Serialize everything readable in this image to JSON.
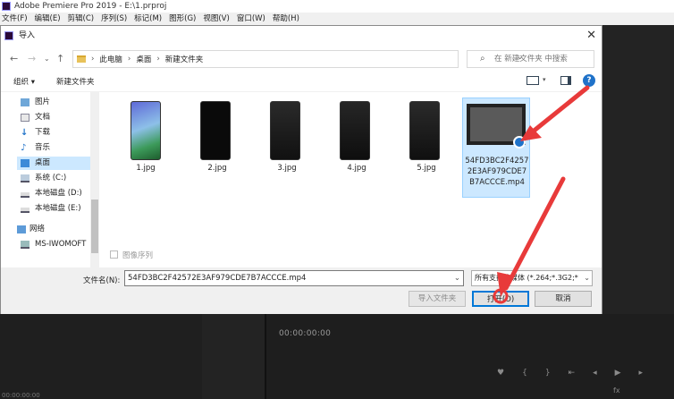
{
  "app": {
    "title": "Adobe Premiere Pro 2019 - E:\\1.prproj",
    "menu": [
      "文件(F)",
      "编辑(E)",
      "剪辑(C)",
      "序列(S)",
      "标记(M)",
      "图形(G)",
      "视图(V)",
      "窗口(W)",
      "帮助(H)"
    ],
    "program_timecode": "00:00:00:00",
    "source_timecode": "00:00:00:00",
    "fx_label": "fx"
  },
  "dialog": {
    "title": "导入",
    "breadcrumb": [
      "此电脑",
      "桌面",
      "新建文件夹"
    ],
    "search_placeholder": "在 新建文件夹 中搜索",
    "toolbar": {
      "organize": "组织 ▾",
      "new_folder": "新建文件夹"
    },
    "sidebar": [
      {
        "label": "图片",
        "icon": "pictures-icon"
      },
      {
        "label": "文档",
        "icon": "documents-icon"
      },
      {
        "label": "下载",
        "icon": "download-icon"
      },
      {
        "label": "音乐",
        "icon": "music-icon"
      },
      {
        "label": "桌面",
        "icon": "desktop-icon",
        "selected": true
      },
      {
        "label": "系统 (C:)",
        "icon": "drive-icon"
      },
      {
        "label": "本地磁盘 (D:)",
        "icon": "drive-icon"
      },
      {
        "label": "本地磁盘 (E:)",
        "icon": "drive-icon"
      },
      {
        "label": "网络",
        "icon": "network-icon"
      },
      {
        "label": "MS-IWOMOFT",
        "icon": "computer-icon"
      }
    ],
    "files": [
      {
        "name": "1.jpg"
      },
      {
        "name": "2.jpg"
      },
      {
        "name": "3.jpg"
      },
      {
        "name": "4.jpg"
      },
      {
        "name": "5.jpg"
      },
      {
        "name": "54FD3BC2F42572E3AF979CDE7B7ACCCE.mp4",
        "selected": true
      }
    ],
    "image_sequence_label": "图像序列",
    "filename_label": "文件名(N):",
    "filename_value": "54FD3BC2F42572E3AF979CDE7B7ACCCE.mp4",
    "filetype_value": "所有支持的媒体 (*.264;*.3G2;*",
    "import_folder_button": "导入文件夹",
    "open_button": "打开(O)",
    "cancel_button": "取消"
  },
  "colors": {
    "accent": "#0078d7",
    "annotation_arrow": "#e83a3a",
    "selection": "#cce8ff"
  }
}
